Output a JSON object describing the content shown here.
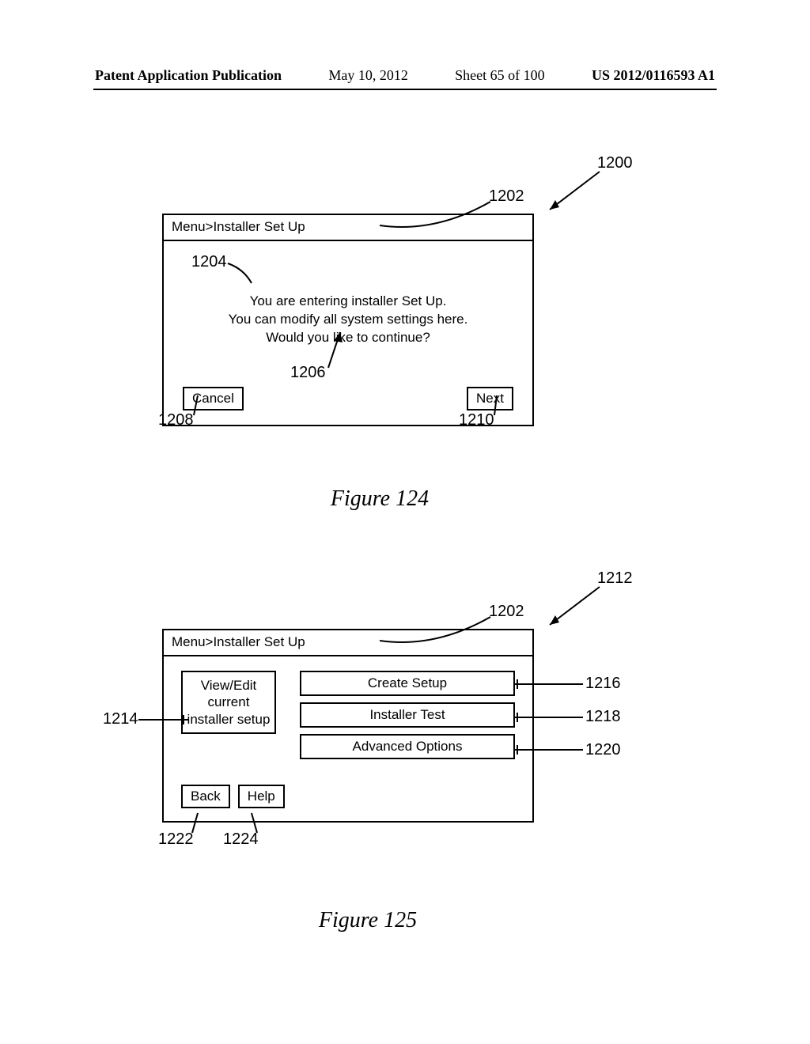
{
  "header": {
    "publication": "Patent Application Publication",
    "date": "May 10, 2012",
    "sheet": "Sheet 65 of 100",
    "number": "US 2012/0116593 A1"
  },
  "fig124": {
    "breadcrumb": "Menu>Installer Set Up",
    "msg_line1": "You are entering installer Set Up.",
    "msg_line2": "You can modify all system settings here.",
    "msg_line3": "Would you like to continue?",
    "cancel": "Cancel",
    "next": "Next",
    "caption": "Figure 124",
    "ref": {
      "r1200": "1200",
      "r1202": "1202",
      "r1204": "1204",
      "r1206": "1206",
      "r1208": "1208",
      "r1210": "1210"
    }
  },
  "fig125": {
    "breadcrumb": "Menu>Installer Set Up",
    "viewedit": "View/Edit current installer setup",
    "create": "Create Setup",
    "test": "Installer Test",
    "adv": "Advanced Options",
    "back": "Back",
    "help": "Help",
    "caption": "Figure 125",
    "ref": {
      "r1212": "1212",
      "r1202": "1202",
      "r1214": "1214",
      "r1216": "1216",
      "r1218": "1218",
      "r1220": "1220",
      "r1222": "1222",
      "r1224": "1224"
    }
  }
}
